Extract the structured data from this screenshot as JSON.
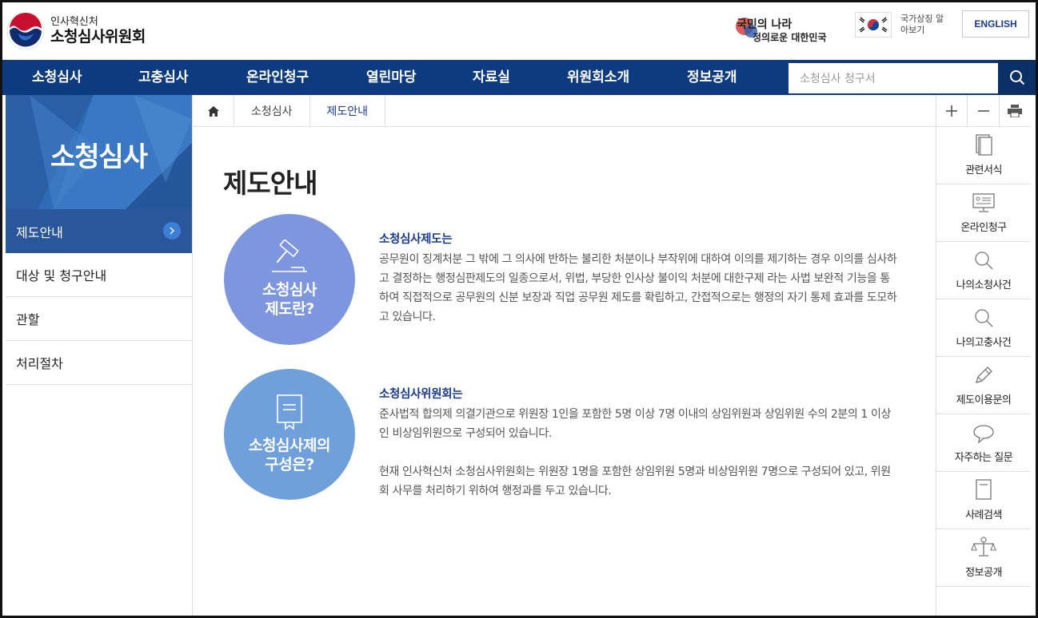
{
  "header": {
    "org": "인사혁신처",
    "site_name": "소청심사위원회",
    "slogan_line1": "국민의 나라",
    "slogan_line2": "정의로운 대한민국",
    "national_symbol": "국가상징 알아보기",
    "english": "ENGLISH"
  },
  "gnb": {
    "items": [
      "소청심사",
      "고충심사",
      "온라인청구",
      "열린마당",
      "자료실",
      "위원회소개",
      "정보공개"
    ],
    "search_placeholder": "소청심사 청구서"
  },
  "lnb": {
    "title": "소청심사",
    "items": [
      "제도안내",
      "대상 및 청구안내",
      "관할",
      "처리절차"
    ],
    "active_index": 0
  },
  "breadcrumb": [
    "소청심사",
    "제도안내"
  ],
  "quick_menu": [
    "관련서식",
    "온라인청구",
    "나의소청사건",
    "나의고충사건",
    "제도이용문의",
    "자주하는 질문",
    "사례검색",
    "정보공개"
  ],
  "icons": {
    "home": "home-icon",
    "search": "search-icon",
    "zoom_in": "plus-icon",
    "zoom_out": "minus-icon",
    "print": "print-icon",
    "gavel": "gavel-icon",
    "book": "book-icon",
    "chevron": "chevron-right-icon"
  },
  "colors": {
    "gnb": "#0e3b80",
    "lnb_active": "#2a569b",
    "circle_1": "#7d96de",
    "circle_2": "#6fa0dc",
    "accent_text": "#1a3b8a"
  },
  "content": {
    "title": "제도안내",
    "section1": {
      "circle_line1": "소청심사",
      "circle_line2": "제도란?",
      "heading": "소청심사제도는",
      "body": "공무원이 징계처분 그 밖에 그 의사에 반하는 불리한 처분이나 부작위에 대하여 이의를 제기하는 경우 이의를 심사하고 결정하는 행정심판제도의 일종으로서, 위법, 부당한 인사상 불이익 처분에 대한구제 라는 사법 보완적 기능을 통하여 직접적으로 공무원의 신분 보장과 직업 공무원 제도를 확립하고, 간접적으로는 행정의 자기 통제 효과를 도모하고 있습니다."
    },
    "section2": {
      "circle_line1": "소청심사제의",
      "circle_line2": "구성은?",
      "heading": "소청심사위원회는",
      "body1": "준사법적 합의제 의결기관으로 위원장 1인을 포함한 5명 이상 7명 이내의 상임위원과 상임위원 수의 2분의 1 이상인 비상임위원으로 구성되어 있습니다.",
      "body2": "현재 인사혁신처 소청심사위원회는 위원장 1명을 포함한 상임위원 5명과 비상임위원 7명으로 구성되어 있고, 위원회 사무를 처리하기 위하여 행정과를 두고 있습니다."
    }
  }
}
